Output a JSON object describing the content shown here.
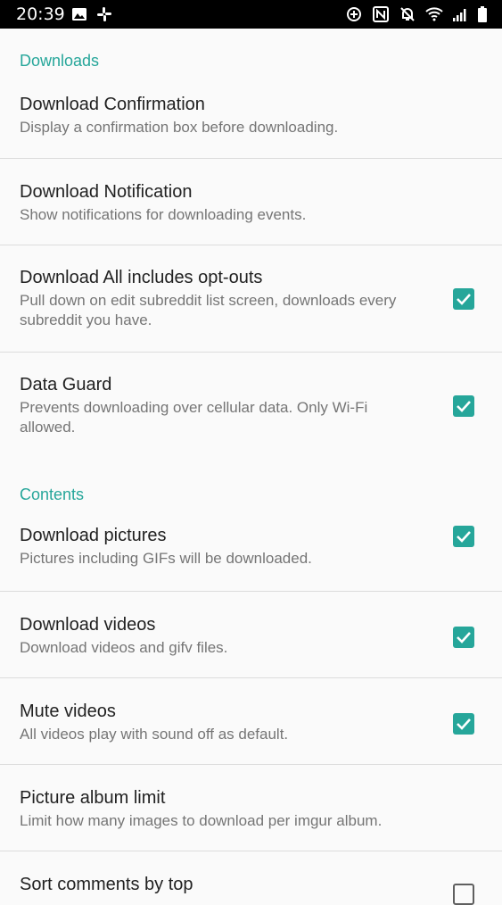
{
  "status_bar": {
    "time": "20:39",
    "left_icons": [
      "image-icon",
      "slack-icon"
    ],
    "right_icons": [
      "data-saver-icon",
      "nfc-icon",
      "notifications-off-icon",
      "wifi-icon",
      "signal-icon",
      "battery-icon"
    ]
  },
  "sections": {
    "downloads": {
      "header": "Downloads",
      "items": [
        {
          "title": "Download Confirmation",
          "summary": "Display a confirmation box before downloading."
        },
        {
          "title": "Download Notification",
          "summary": "Show notifications for downloading events."
        },
        {
          "title": "Download All includes opt-outs",
          "summary": "Pull down on edit subreddit list screen, downloads every subreddit you have.",
          "checked": true
        },
        {
          "title": "Data Guard",
          "summary": "Prevents downloading over cellular data. Only Wi-Fi allowed.",
          "checked": true
        }
      ]
    },
    "contents": {
      "header": "Contents",
      "items": [
        {
          "title": "Download pictures",
          "summary": "Pictures including GIFs will be downloaded.",
          "checked": true
        },
        {
          "title": "Download videos",
          "summary": "Download videos and gifv files.",
          "checked": true
        },
        {
          "title": "Mute videos",
          "summary": "All videos play with sound off as default.",
          "checked": true
        },
        {
          "title": "Picture album limit",
          "summary": "Limit how many images to download per imgur album."
        },
        {
          "title": "Sort comments by top",
          "checked": false
        }
      ]
    }
  },
  "colors": {
    "accent": "#26a69a",
    "background": "#fafafa",
    "title_text": "#212121",
    "summary_text": "#757575",
    "divider": "#dcdcdc",
    "status_bar": "#000000"
  }
}
